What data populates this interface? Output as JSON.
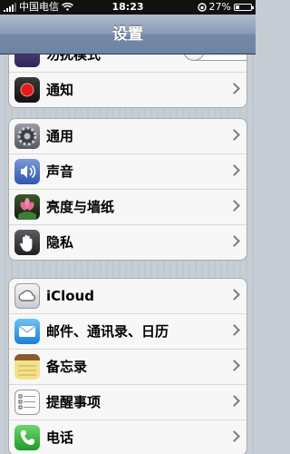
{
  "status_bar": {
    "carrier": "中国电信",
    "time": "18:23",
    "battery": "27%",
    "battery_level": 0.27
  },
  "nav": {
    "title": "设置"
  },
  "groups": [
    {
      "items": [
        {
          "label": "勿扰模式",
          "icon": "moon-icon",
          "control": "toggle"
        },
        {
          "label": "通知",
          "icon": "notifications-icon",
          "control": "chevron"
        }
      ]
    },
    {
      "items": [
        {
          "label": "通用",
          "icon": "general-gear-icon"
        },
        {
          "label": "声音",
          "icon": "sound-speaker-icon"
        },
        {
          "label": "亮度与墙纸",
          "icon": "wallpaper-flower-icon"
        },
        {
          "label": "隐私",
          "icon": "privacy-hand-icon"
        }
      ]
    },
    {
      "items": [
        {
          "label": "iCloud",
          "icon": "icloud-icon"
        },
        {
          "label": "邮件、通讯录、日历",
          "icon": "mail-icon"
        },
        {
          "label": "备忘录",
          "icon": "notes-icon"
        },
        {
          "label": "提醒事项",
          "icon": "reminders-icon"
        },
        {
          "label": "电话",
          "icon": "phone-icon"
        }
      ]
    }
  ]
}
